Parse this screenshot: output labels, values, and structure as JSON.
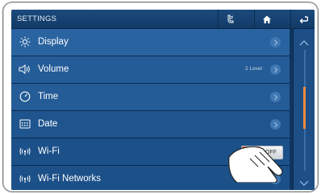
{
  "header": {
    "title": "SETTINGS"
  },
  "icons": {
    "phone": "phone-icon",
    "home": "home-icon",
    "back": "back-icon"
  },
  "items": [
    {
      "label": "Display",
      "icon": "brightness-icon",
      "value": ""
    },
    {
      "label": "Volume",
      "icon": "speaker-icon",
      "value": "2 Level"
    },
    {
      "label": "Time",
      "icon": "clock-icon",
      "value": ""
    },
    {
      "label": "Date",
      "icon": "calendar-icon",
      "value": ""
    },
    {
      "label": "Wi-Fi",
      "icon": "wifi-icon",
      "toggle": "OFF"
    },
    {
      "label": "Wi-Fi Networks",
      "icon": "wifi-icon",
      "value": ""
    }
  ],
  "colors": {
    "accent": "#f28a3c",
    "header": "#123a66",
    "row": "#245c97"
  }
}
